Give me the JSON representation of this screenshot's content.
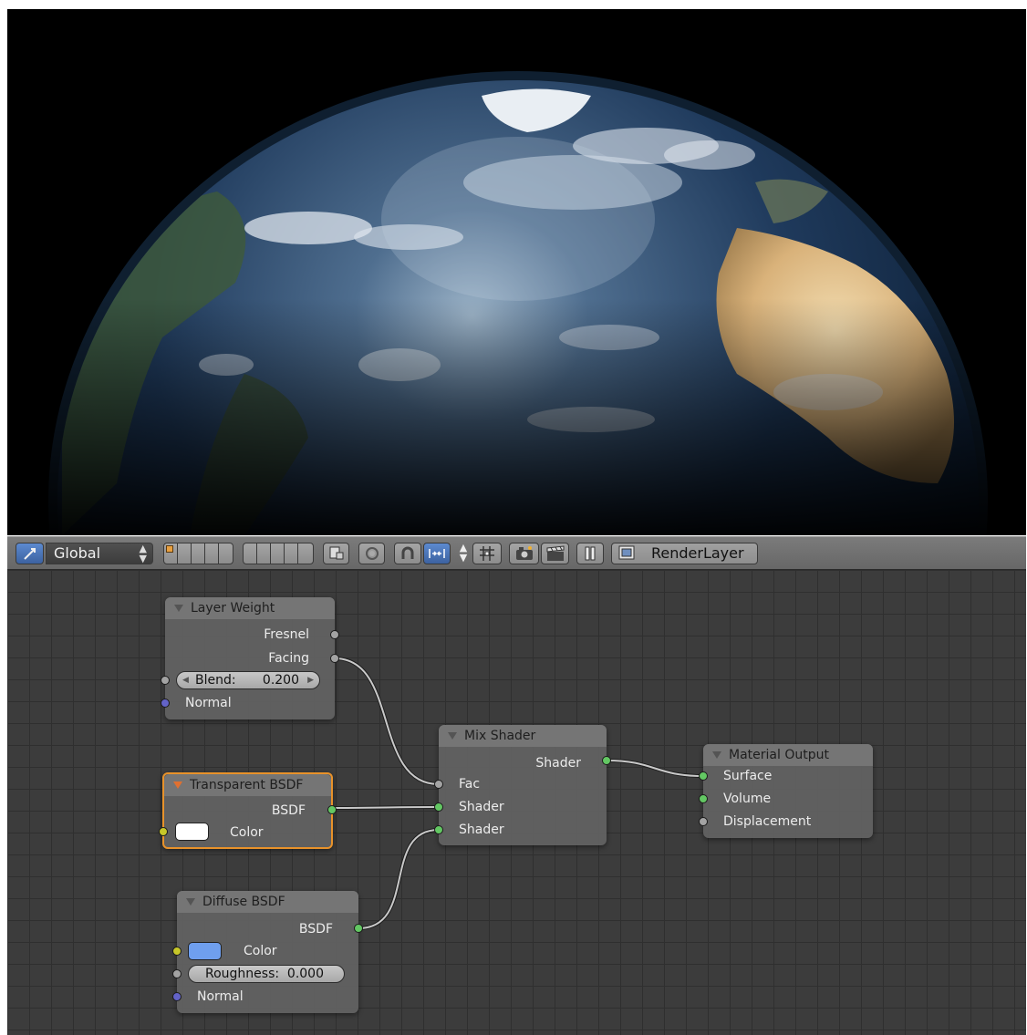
{
  "toolbar": {
    "transform_orientation": "Global",
    "render_layer": "RenderLayer",
    "accent_color": "#5c8ad0"
  },
  "nodes": {
    "layer_weight": {
      "title": "Layer Weight",
      "outputs": [
        "Fresnel",
        "Facing"
      ],
      "blend_label": "Blend:",
      "blend_value": "0.200",
      "normal_label": "Normal"
    },
    "transparent_bsdf": {
      "title": "Transparent BSDF",
      "output": "BSDF",
      "color_label": "Color",
      "color_value": "#ffffff"
    },
    "diffuse_bsdf": {
      "title": "Diffuse BSDF",
      "output": "BSDF",
      "color_label": "Color",
      "color_value": "#6f9fee",
      "roughness_label": "Roughness:",
      "roughness_value": "0.000",
      "normal_label": "Normal"
    },
    "mix_shader": {
      "title": "Mix Shader",
      "output": "Shader",
      "inputs": [
        "Fac",
        "Shader",
        "Shader"
      ]
    },
    "material_output": {
      "title": "Material Output",
      "inputs": [
        "Surface",
        "Volume",
        "Displacement"
      ]
    }
  },
  "socket_colors": {
    "float": "#a3a3a3",
    "shader": "#63c763",
    "color": "#c7c729",
    "vector": "#6363c7"
  }
}
